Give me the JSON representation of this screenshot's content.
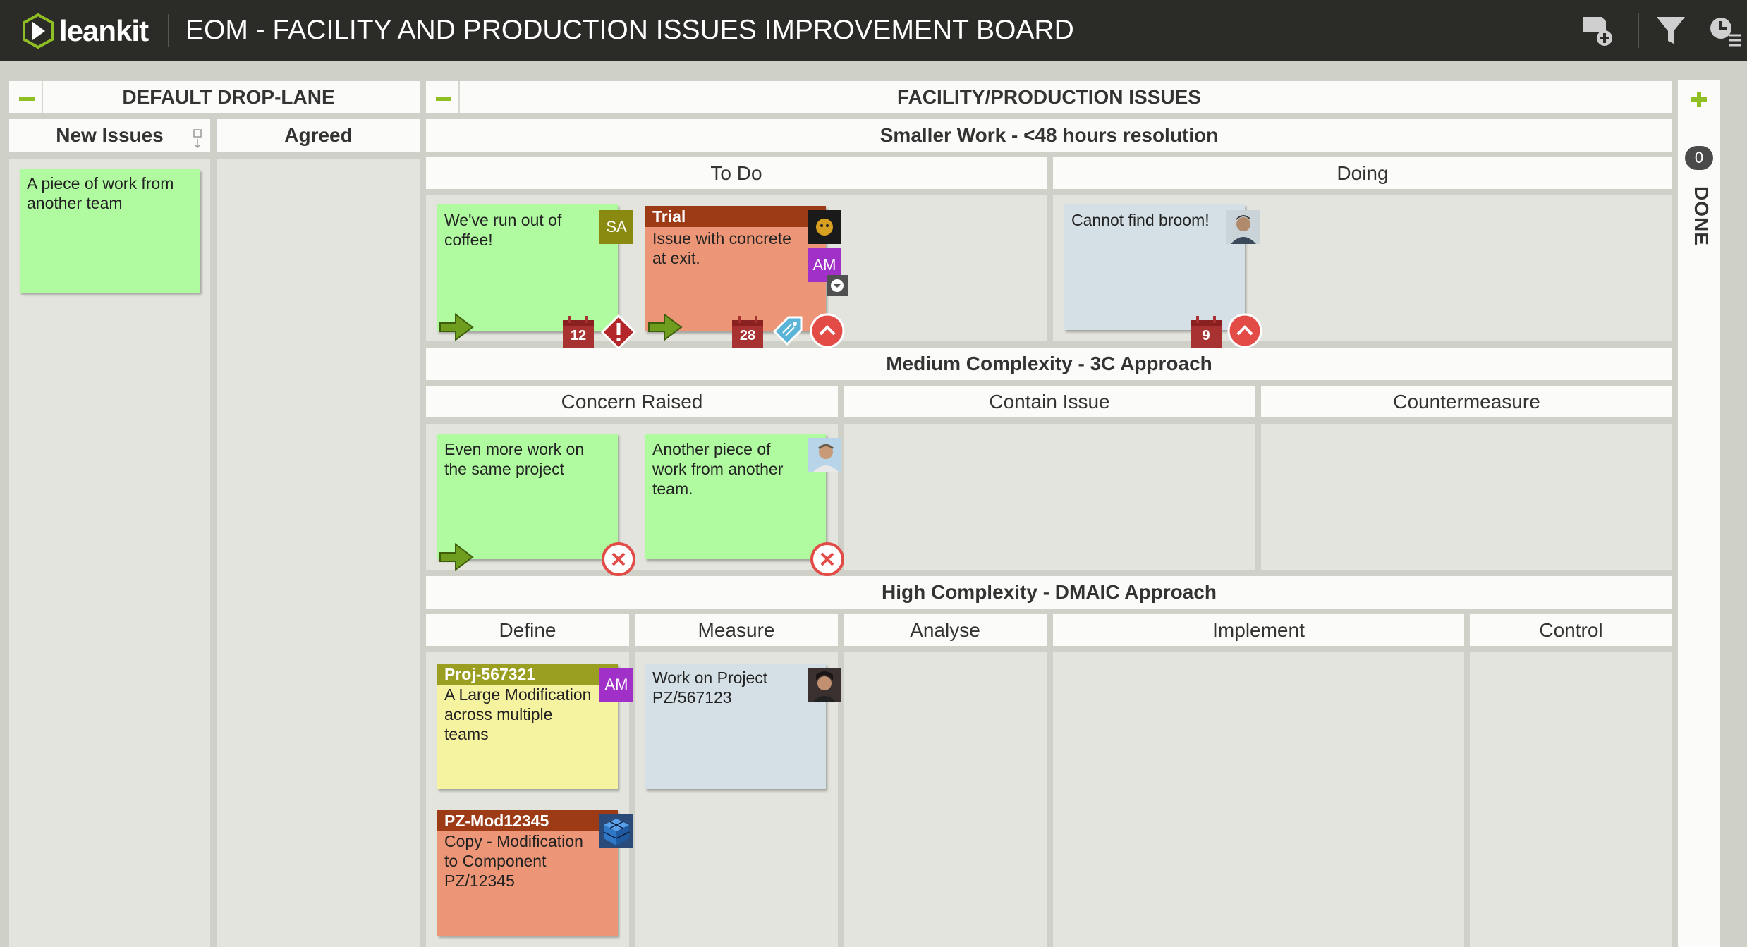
{
  "app": {
    "logo_text": "leankit",
    "board_title": "EOM - FACILITY AND PRODUCTION ISSUES IMPROVEMENT BOARD"
  },
  "toolbar": {
    "icons": [
      "add-card-icon",
      "filter-icon",
      "clock-menu-icon"
    ]
  },
  "lanes": {
    "default_drop_lane": "DEFAULT DROP-LANE",
    "new_issues": "New Issues",
    "agreed": "Agreed",
    "facility": "FACILITY/PRODUCTION ISSUES",
    "smaller_work": "Smaller Work - <48 hours resolution",
    "to_do": "To Do",
    "doing": "Doing",
    "medium": "Medium Complexity - 3C Approach",
    "concern_raised": "Concern Raised",
    "contain_issue": "Contain Issue",
    "countermeasure": "Countermeasure",
    "high": "High Complexity - DMAIC Approach",
    "define": "Define",
    "measure": "Measure",
    "analyse": "Analyse",
    "implement": "Implement",
    "control": "Control",
    "done": "DONE",
    "done_count": "0"
  },
  "cards": {
    "new_issue": {
      "text": "A piece of work from another team"
    },
    "coffee": {
      "text": "We've run out of coffee!",
      "avatar": "SA",
      "due_day": "12"
    },
    "trial": {
      "header": "Trial",
      "text": "Issue with concrete at exit.",
      "avatar": "AM",
      "due_day": "28"
    },
    "broom": {
      "text": "Cannot find broom!",
      "due_day": "9"
    },
    "more_work": {
      "text": "Even more work on the same project"
    },
    "another_piece": {
      "text": "Another piece of work from another team."
    },
    "proj": {
      "header": "Proj-567321",
      "text": "A Large Modification across multiple teams",
      "avatar": "AM"
    },
    "work_on_project": {
      "text": "Work on Project PZ/567123"
    },
    "pz_mod": {
      "header": "PZ-Mod12345",
      "text": "Copy - Modification to Component PZ/12345"
    }
  },
  "colors": {
    "topbar": "#2b2b27",
    "accent_green": "#8fbf22",
    "card_green": "#b0fba0",
    "card_orange": "#ed9677",
    "card_blue": "#d5e0e6",
    "card_yellow": "#f5f3a0",
    "header_olive": "#9a9f22",
    "header_rust": "#9c3b16",
    "alert_red": "#e24b46"
  }
}
